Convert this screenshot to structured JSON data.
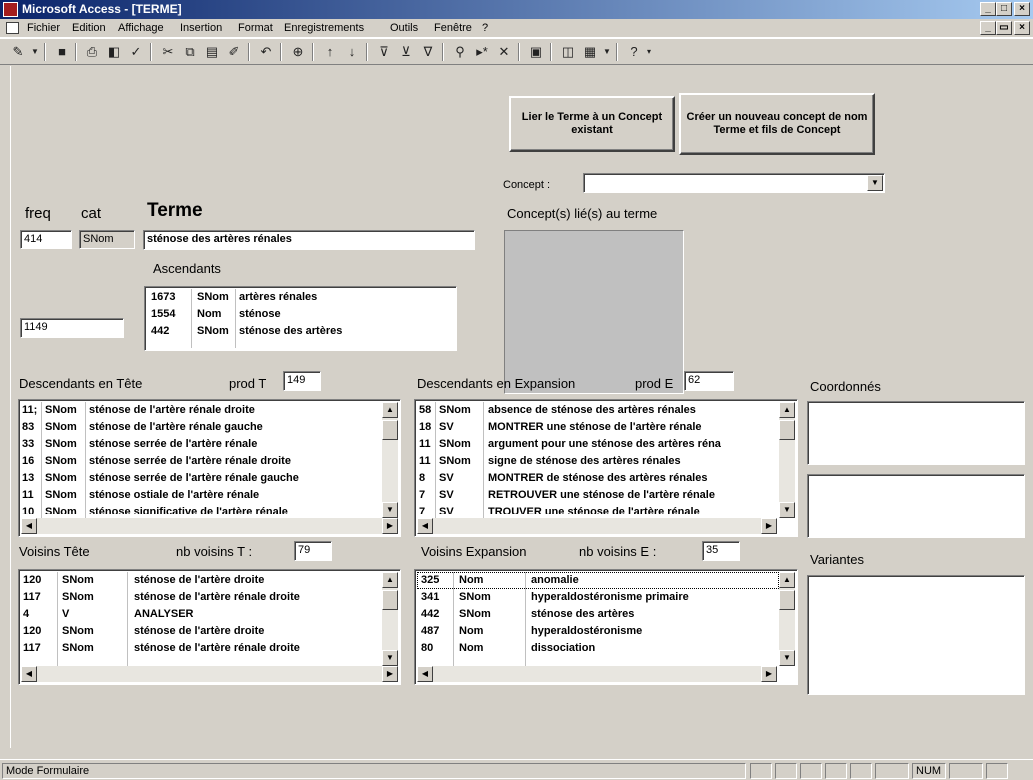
{
  "window": {
    "title": "Microsoft Access - [TERME]",
    "min_btn": "_",
    "max_btn": "□",
    "close_btn": "×",
    "child_min": "_",
    "child_restore": "▭",
    "child_close": "×"
  },
  "menu": {
    "items": [
      "Fichier",
      "Edition",
      "Affichage",
      "Insertion",
      "Format",
      "Enregistrements",
      "Outils",
      "Fenêtre",
      "?"
    ]
  },
  "form": {
    "btn_lier": "Lier le Terme à un Concept existant",
    "btn_creer": "Créer un nouveau concept de nom Terme et fils de Concept",
    "concept_label": "Concept :",
    "concept_value": "",
    "concepts_lies_label": "Concept(s) lié(s) au terme",
    "freq_label": "freq",
    "cat_label": "cat",
    "terme_label": "Terme",
    "freq_value": "414",
    "cat_value": "SNom",
    "terme_value": "sténose des artères rénales",
    "ascendants_label": "Ascendants",
    "ascendants": [
      {
        "id": "1673",
        "cat": "SNom",
        "text": "artères rénales"
      },
      {
        "id": "1554",
        "cat": "Nom",
        "text": "sténose"
      },
      {
        "id": "442",
        "cat": "SNom",
        "text": "sténose des artères"
      }
    ],
    "left_value": "1149",
    "desc_tete_label": "Descendants en Tête",
    "prod_t_label": "prod T",
    "prod_t_value": "149",
    "desc_tete": [
      {
        "id": "11;",
        "cat": "SNom",
        "text": "sténose de l'artère rénale droite"
      },
      {
        "id": "83",
        "cat": "SNom",
        "text": "sténose de l'artère rénale gauche"
      },
      {
        "id": "33",
        "cat": "SNom",
        "text": "sténose serrée de l'artère rénale"
      },
      {
        "id": "16",
        "cat": "SNom",
        "text": "sténose serrée de l'artère rénale droite"
      },
      {
        "id": "13",
        "cat": "SNom",
        "text": "sténose serrée de l'artère rénale gauche"
      },
      {
        "id": "11",
        "cat": "SNom",
        "text": "sténose ostiale de l'artère rénale"
      },
      {
        "id": "10",
        "cat": "SNom",
        "text": "sténose significative de l'artère rénale"
      }
    ],
    "desc_exp_label": "Descendants en Expansion",
    "prod_e_label": "prod E",
    "prod_e_value": "62",
    "desc_exp": [
      {
        "id": "58",
        "cat": "SNom",
        "text": "absence de sténose des artères rénales"
      },
      {
        "id": "18",
        "cat": "SV",
        "text": "MONTRER une sténose de l'artère rénale"
      },
      {
        "id": "11",
        "cat": "SNom",
        "text": "argument pour une sténose des artères réna"
      },
      {
        "id": "11",
        "cat": "SNom",
        "text": "signe de sténose des artères rénales"
      },
      {
        "id": "8",
        "cat": "SV",
        "text": "MONTRER de sténose des artères rénales"
      },
      {
        "id": "7",
        "cat": "SV",
        "text": "RETROUVER une sténose de l'artère rénale"
      },
      {
        "id": "7",
        "cat": "SV",
        "text": "TROUVER une sténose de l'artère rénale"
      }
    ],
    "coordonnes_label": "Coordonnés",
    "voisins_tete_label": "Voisins Tête",
    "nb_voisins_t_label": "nb voisins T :",
    "nb_voisins_t_value": "79",
    "voisins_tete": [
      {
        "id": "120",
        "cat": "SNom",
        "text": "sténose de l'artère droite"
      },
      {
        "id": "117",
        "cat": "SNom",
        "text": "sténose de l'artère rénale droite"
      },
      {
        "id": "4",
        "cat": "V",
        "text": "ANALYSER"
      },
      {
        "id": "120",
        "cat": "SNom",
        "text": "sténose de l'artère droite"
      },
      {
        "id": "117",
        "cat": "SNom",
        "text": "sténose de l'artère rénale droite"
      }
    ],
    "voisins_exp_label": "Voisins Expansion",
    "nb_voisins_e_label": "nb voisins E :",
    "nb_voisins_e_value": "35",
    "voisins_exp": [
      {
        "id": "325",
        "cat": "Nom",
        "text": "anomalie"
      },
      {
        "id": "341",
        "cat": "SNom",
        "text": "hyperaldostéronisme primaire"
      },
      {
        "id": "442",
        "cat": "SNom",
        "text": "sténose des artères"
      },
      {
        "id": "487",
        "cat": "Nom",
        "text": "hyperaldostéronisme"
      },
      {
        "id": "80",
        "cat": "Nom",
        "text": "dissociation"
      }
    ],
    "variantes_label": "Variantes"
  },
  "status": {
    "mode": "Mode Formulaire",
    "num": "NUM"
  },
  "icons": {
    "up": "▲",
    "down": "▼",
    "left": "◀",
    "right": "▶"
  }
}
